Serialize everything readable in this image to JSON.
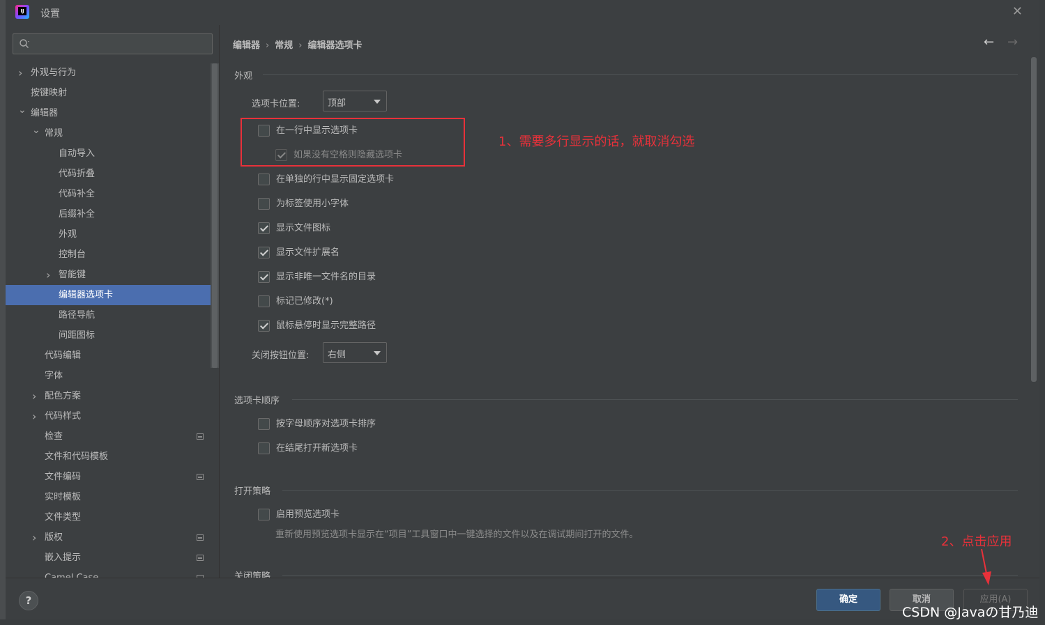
{
  "window": {
    "title": "设置"
  },
  "search": {
    "placeholder": ""
  },
  "tree": {
    "items": [
      {
        "label": "外观与行为",
        "level": 0,
        "arrow": "›",
        "badge": false,
        "selected": false
      },
      {
        "label": "按键映射",
        "level": 0,
        "arrow": "",
        "badge": false,
        "selected": false
      },
      {
        "label": "编辑器",
        "level": 0,
        "arrow": "⌄",
        "badge": false,
        "selected": false
      },
      {
        "label": "常规",
        "level": 1,
        "arrow": "⌄",
        "badge": false,
        "selected": false
      },
      {
        "label": "自动导入",
        "level": 2,
        "arrow": "",
        "badge": false,
        "selected": false
      },
      {
        "label": "代码折叠",
        "level": 2,
        "arrow": "",
        "badge": false,
        "selected": false
      },
      {
        "label": "代码补全",
        "level": 2,
        "arrow": "",
        "badge": false,
        "selected": false
      },
      {
        "label": "后缀补全",
        "level": 2,
        "arrow": "",
        "badge": false,
        "selected": false
      },
      {
        "label": "外观",
        "level": 2,
        "arrow": "",
        "badge": false,
        "selected": false
      },
      {
        "label": "控制台",
        "level": 2,
        "arrow": "",
        "badge": false,
        "selected": false
      },
      {
        "label": "智能键",
        "level": 2,
        "arrow": "›",
        "badge": false,
        "selected": false
      },
      {
        "label": "编辑器选项卡",
        "level": 2,
        "arrow": "",
        "badge": false,
        "selected": true
      },
      {
        "label": "路径导航",
        "level": 2,
        "arrow": "",
        "badge": false,
        "selected": false
      },
      {
        "label": "间距图标",
        "level": 2,
        "arrow": "",
        "badge": false,
        "selected": false
      },
      {
        "label": "代码编辑",
        "level": 1,
        "arrow": "",
        "badge": false,
        "selected": false
      },
      {
        "label": "字体",
        "level": 1,
        "arrow": "",
        "badge": false,
        "selected": false
      },
      {
        "label": "配色方案",
        "level": 1,
        "arrow": "›",
        "badge": false,
        "selected": false
      },
      {
        "label": "代码样式",
        "level": 1,
        "arrow": "›",
        "badge": false,
        "selected": false
      },
      {
        "label": "检查",
        "level": 1,
        "arrow": "",
        "badge": true,
        "selected": false
      },
      {
        "label": "文件和代码模板",
        "level": 1,
        "arrow": "",
        "badge": false,
        "selected": false
      },
      {
        "label": "文件编码",
        "level": 1,
        "arrow": "",
        "badge": true,
        "selected": false
      },
      {
        "label": "实时模板",
        "level": 1,
        "arrow": "",
        "badge": false,
        "selected": false
      },
      {
        "label": "文件类型",
        "level": 1,
        "arrow": "",
        "badge": false,
        "selected": false
      },
      {
        "label": "版权",
        "level": 1,
        "arrow": "›",
        "badge": true,
        "selected": false
      },
      {
        "label": "嵌入提示",
        "level": 1,
        "arrow": "",
        "badge": true,
        "selected": false
      },
      {
        "label": "Camel Case",
        "level": 1,
        "arrow": "",
        "badge": true,
        "selected": false
      }
    ]
  },
  "breadcrumb": {
    "part1": "编辑器",
    "part2": "常规",
    "part3": "编辑器选项卡",
    "sep": "›"
  },
  "nav": {
    "back": "←",
    "forward": "→"
  },
  "appearance": {
    "title": "外观",
    "tab_position_label": "选项卡位置:",
    "tab_position_value": "顶部",
    "checkboxes": [
      {
        "label": "在一行中显示选项卡",
        "checked": false,
        "disabled": false
      },
      {
        "label": "如果没有空格则隐藏选项卡",
        "checked": true,
        "disabled": true
      },
      {
        "label": "在单独的行中显示固定选项卡",
        "checked": false,
        "disabled": false
      },
      {
        "label": "为标签使用小字体",
        "checked": false,
        "disabled": false
      },
      {
        "label": "显示文件图标",
        "checked": true,
        "disabled": false
      },
      {
        "label": "显示文件扩展名",
        "checked": true,
        "disabled": false
      },
      {
        "label": "显示非唯一文件名的目录",
        "checked": true,
        "disabled": false
      },
      {
        "label": "标记已修改(*)",
        "checked": false,
        "disabled": false
      },
      {
        "label": "鼠标悬停时显示完整路径",
        "checked": true,
        "disabled": false
      }
    ],
    "close_button_label": "关闭按钮位置:",
    "close_button_value": "右侧"
  },
  "order": {
    "title": "选项卡顺序",
    "checkboxes": [
      {
        "label": "按字母顺序对选项卡排序",
        "checked": false
      },
      {
        "label": "在结尾打开新选项卡",
        "checked": false
      }
    ]
  },
  "opening": {
    "title": "打开策略",
    "preview_label": "启用预览选项卡",
    "preview_checked": false,
    "preview_hint": "重新使用预览选项卡显示在“项目”工具窗口中一键选择的文件以及在调试期间打开的文件。"
  },
  "closing": {
    "title": "关闭策略"
  },
  "annotations": {
    "note1": "1、需要多行显示的话，就取消勾选",
    "note2": "2、点击应用",
    "color": "#e8313a"
  },
  "footer": {
    "help": "?",
    "ok": "确定",
    "cancel": "取消",
    "apply": "应用(A)"
  },
  "watermark": "CSDN @Javaの甘乃迪",
  "colors": {
    "background": "#3c3f41",
    "selection": "#4b6eaf",
    "ok_button": "#365880"
  }
}
